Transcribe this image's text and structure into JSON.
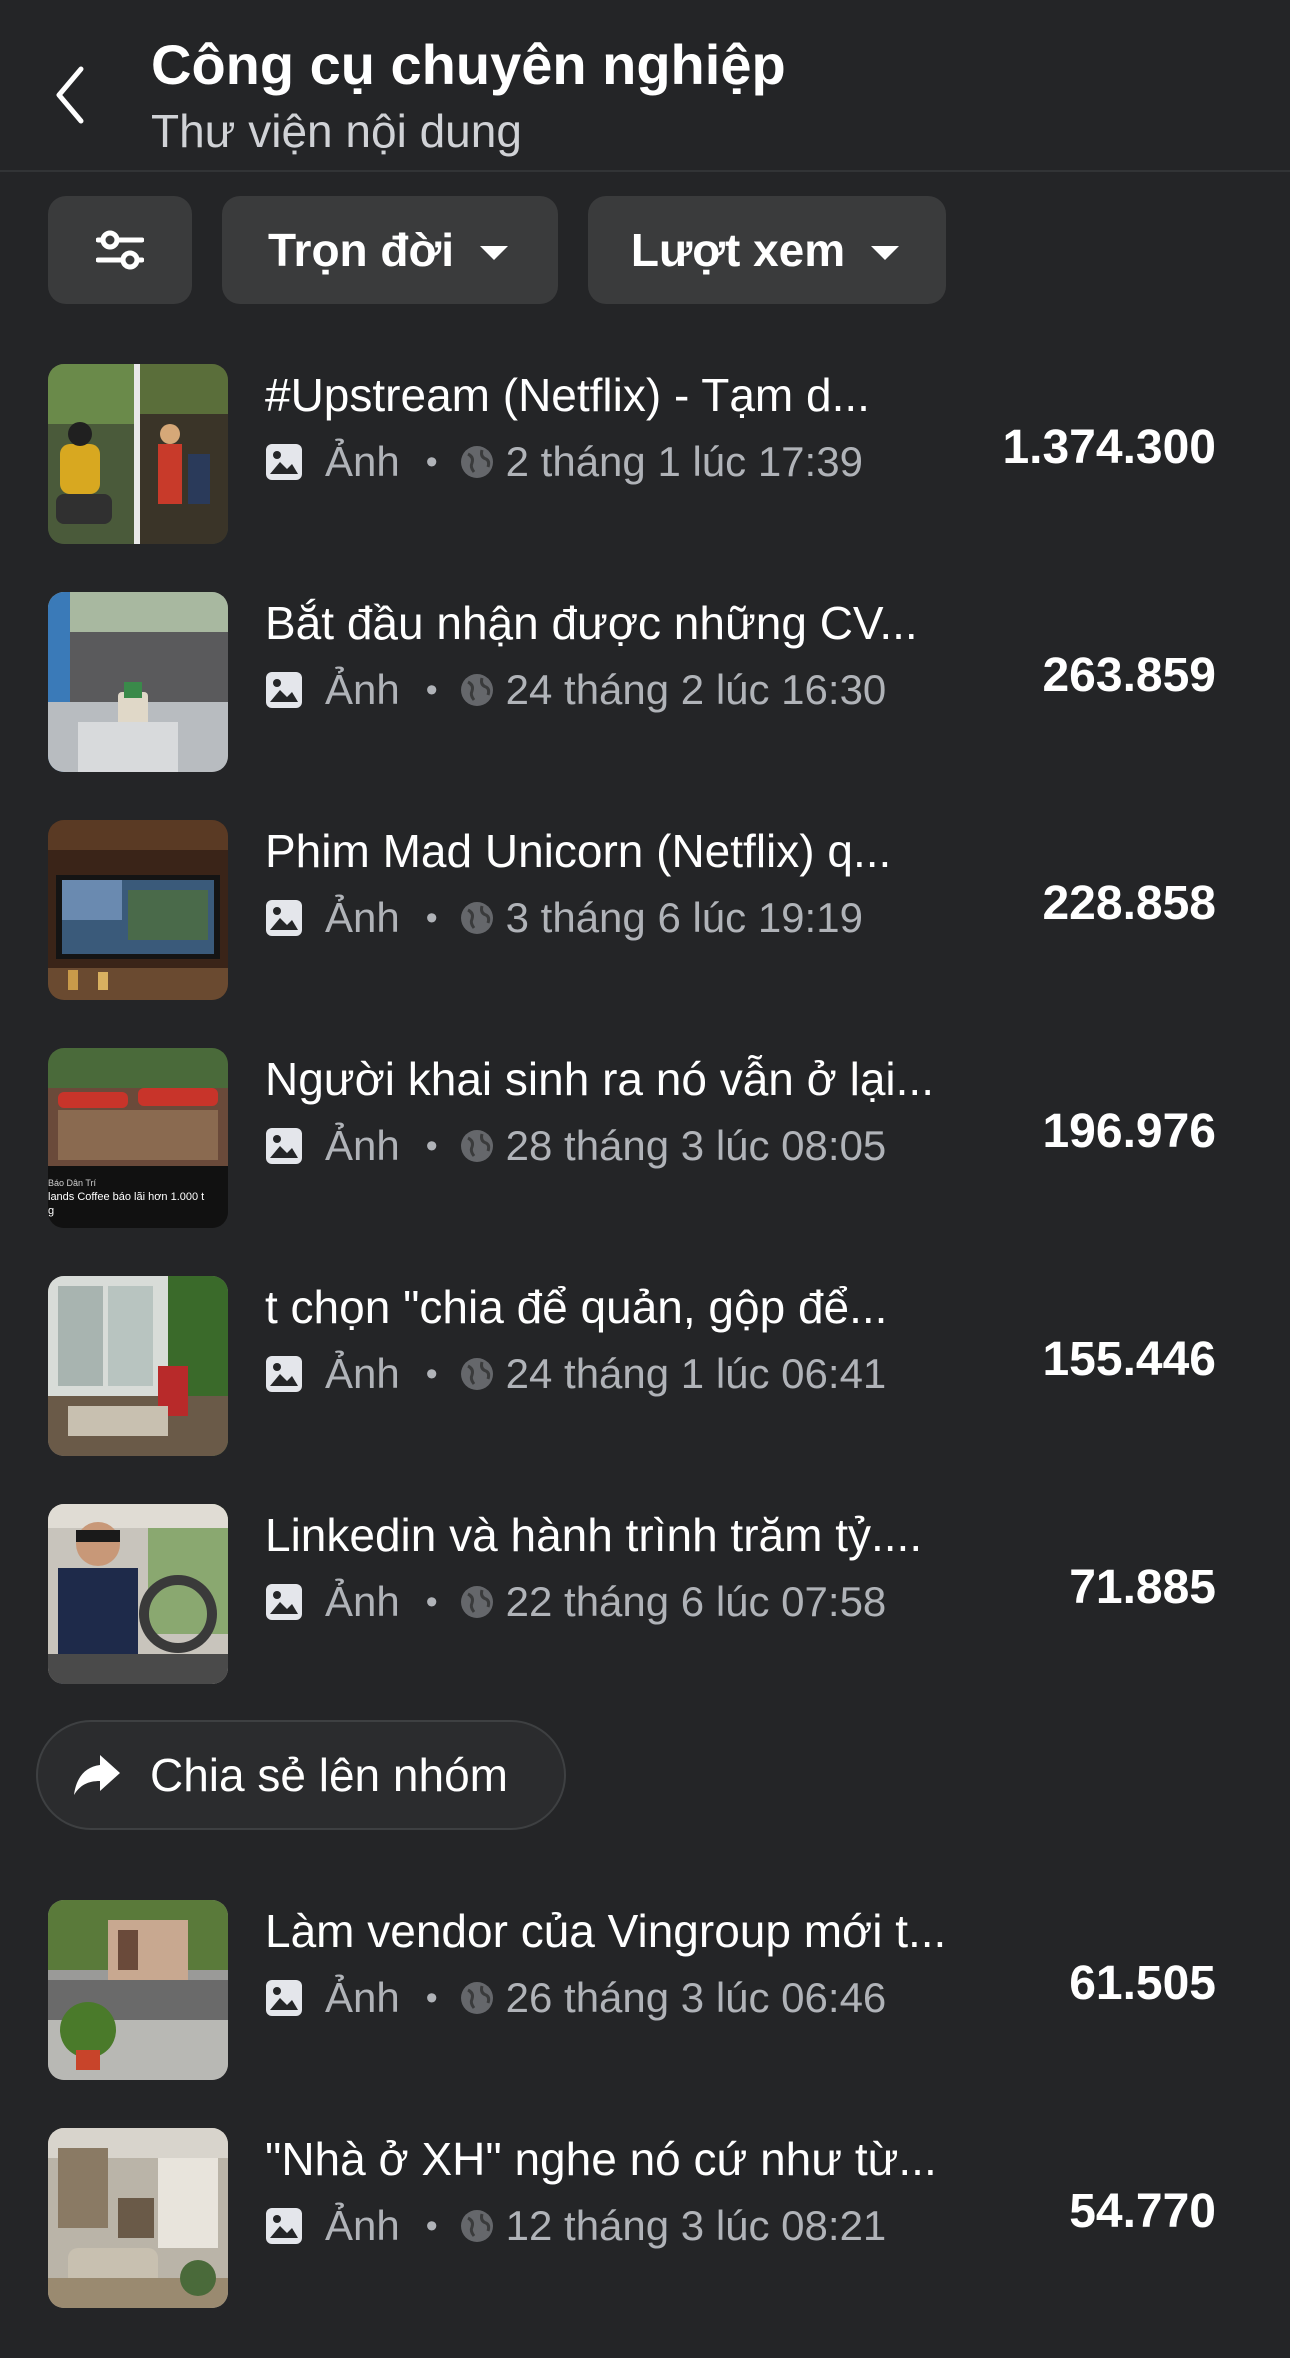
{
  "header": {
    "title": "Công cụ chuyên nghiệp",
    "subtitle": "Thư viện nội dung"
  },
  "filters": {
    "time_label": "Trọn đời",
    "metric_label": "Lượt xem"
  },
  "items": [
    {
      "title": "#Upstream (Netflix) - Tạm d...",
      "type": "Ảnh",
      "date": "2 tháng 1 lúc 17:39",
      "views": "1.374.300"
    },
    {
      "title": "Bắt đầu nhận được những CV...",
      "type": "Ảnh",
      "date": "24 tháng 2 lúc 16:30",
      "views": "263.859"
    },
    {
      "title": "Phim Mad Unicorn (Netflix) q...",
      "type": "Ảnh",
      "date": "3 tháng 6 lúc 19:19",
      "views": "228.858"
    },
    {
      "title": "Người khai sinh ra nó vẫn ở lại...",
      "type": "Ảnh",
      "date": "28 tháng 3 lúc 08:05",
      "views": "196.976"
    },
    {
      "title": "t chọn \"chia để quản, gộp để...",
      "type": "Ảnh",
      "date": "24 tháng 1 lúc 06:41",
      "views": "155.446"
    },
    {
      "title": "Linkedin và hành trình trăm tỷ....",
      "type": "Ảnh",
      "date": "22 tháng 6 lúc 07:58",
      "views": "71.885"
    },
    {
      "title": "Làm vendor của Vingroup mới t...",
      "type": "Ảnh",
      "date": "26 tháng 3 lúc 06:46",
      "views": "61.505"
    },
    {
      "title": "\"Nhà ở XH\" nghe nó cứ như từ...",
      "type": "Ảnh",
      "date": "12 tháng 3 lúc 08:21",
      "views": "54.770"
    }
  ],
  "thumb_text": {
    "line1": "Báo Dân Trí",
    "line2": "lands Coffee báo lãi hơn 1.000 t",
    "line3": "g"
  },
  "share": {
    "label": "Chia sẻ lên nhóm"
  },
  "icons": {
    "back": "chevron-left-icon",
    "filter": "sliders-icon",
    "photo": "photo-icon",
    "audience": "globe-icon",
    "share": "share-arrow-icon"
  }
}
